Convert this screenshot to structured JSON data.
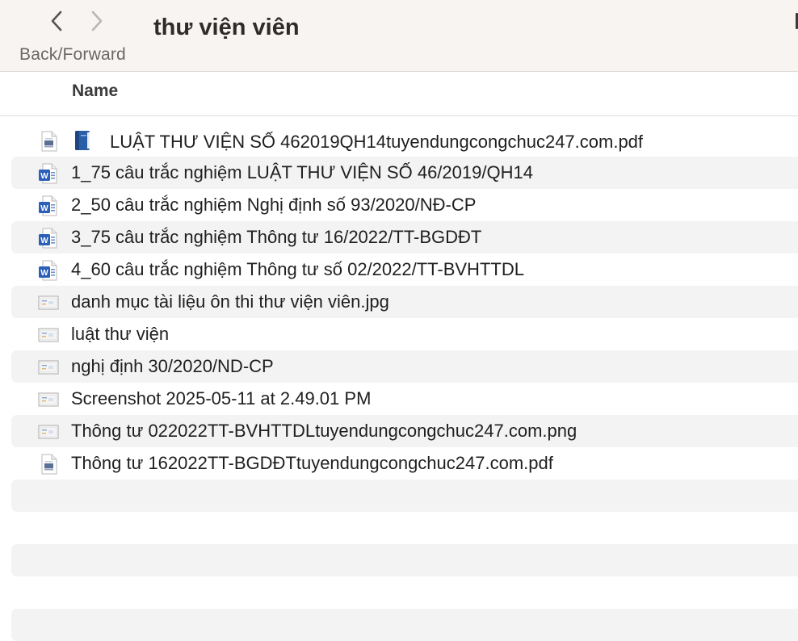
{
  "toolbar": {
    "back_label": "Back/Forward",
    "title": "thư viện viên"
  },
  "columns": {
    "name": "Name"
  },
  "files": [
    {
      "name": "LUẬT THƯ VIỆN SỐ 462019QH14tuyendungcongchuc247.com.pdf",
      "icon": "pdf-file-icon",
      "prefix_icon": "blue-book-icon"
    },
    {
      "name": "1_75 câu trắc nghiệm LUẬT THƯ VIỆN SỐ 46/2019/QH14",
      "icon": "word-doc-icon"
    },
    {
      "name": "2_50 câu trắc nghiệm Nghị định số 93/2020/NĐ-CP",
      "icon": "word-doc-icon"
    },
    {
      "name": "3_75 câu trắc nghiệm Thông tư 16/2022/TT-BGDĐT",
      "icon": "word-doc-icon"
    },
    {
      "name": "4_60 câu trắc nghiệm Thông tư số 02/2022/TT-BVHTTDL",
      "icon": "word-doc-icon"
    },
    {
      "name": "danh mục tài liệu ôn thi thư viện viên.jpg",
      "icon": "image-file-icon"
    },
    {
      "name": "luật thư viện",
      "icon": "image-file-icon"
    },
    {
      "name": "nghị định 30/2020/ND-CP",
      "icon": "image-file-icon"
    },
    {
      "name": "Screenshot 2025-05-11 at 2.49.01 PM",
      "icon": "image-file-icon"
    },
    {
      "name": "Thông tư 022022TT-BVHTTDLtuyendungcongchuc247.com.png",
      "icon": "image-file-icon"
    },
    {
      "name": "Thông tư 162022TT-BGDĐTtuyendungcongchuc247.com.pdf",
      "icon": "pdf-file-icon"
    }
  ],
  "colors": {
    "toolbar_bg": "#f7f4f2",
    "row_alt_bg": "#f3f3f3",
    "word_blue": "#2b5fb8"
  }
}
